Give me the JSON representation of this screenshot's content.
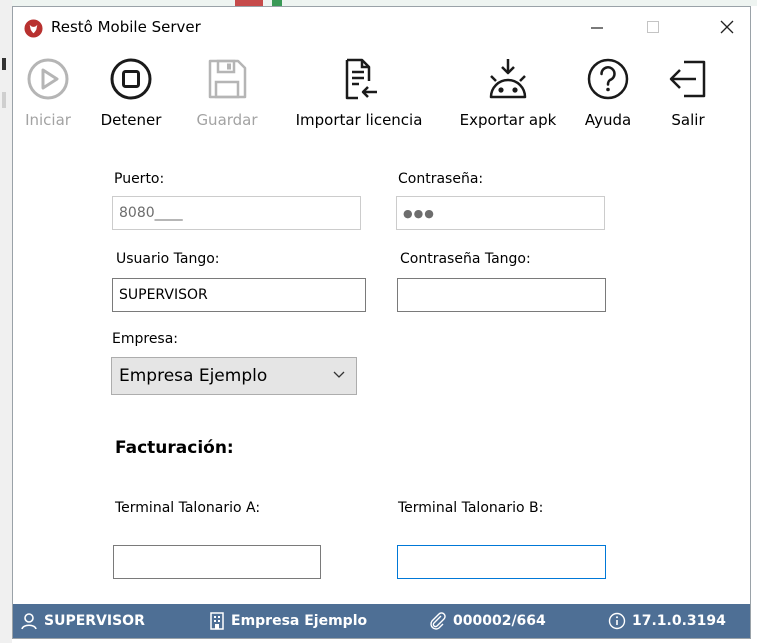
{
  "window": {
    "title": "Restô Mobile Server"
  },
  "toolbar": {
    "iniciar": "Iniciar",
    "detener": "Detener",
    "guardar": "Guardar",
    "importar": "Importar licencia",
    "exportar": "Exportar apk",
    "ayuda": "Ayuda",
    "salir": "Salir"
  },
  "form": {
    "puerto_label": "Puerto:",
    "puerto_value": "8080____",
    "contrasena_label": "Contraseña:",
    "contrasena_value": "●●●",
    "usuario_tango_label": "Usuario Tango:",
    "usuario_tango_value": "SUPERVISOR",
    "contrasena_tango_label": "Contraseña Tango:",
    "contrasena_tango_value": "",
    "empresa_label": "Empresa:",
    "empresa_value": "Empresa Ejemplo",
    "facturacion_heading": "Facturación:",
    "terminal_a_label": "Terminal Talonario A:",
    "terminal_a_value": "",
    "terminal_b_label": "Terminal Talonario B:",
    "terminal_b_value": ""
  },
  "status": {
    "user": "SUPERVISOR",
    "company": "Empresa Ejemplo",
    "license": "000002/664",
    "version": "17.1.0.3194"
  },
  "colors": {
    "statusbar": "#4e6f95",
    "focus": "#0078d7",
    "disabled_text": "#a3a3a3",
    "app_icon": "#b8312f"
  },
  "icons": [
    "play-icon",
    "stop-icon",
    "save-icon",
    "import-license-icon",
    "android-download-icon",
    "help-icon",
    "exit-icon",
    "user-icon",
    "building-icon",
    "paperclip-icon",
    "info-icon",
    "chevron-down-icon",
    "minimize-icon",
    "maximize-icon",
    "close-icon"
  ]
}
